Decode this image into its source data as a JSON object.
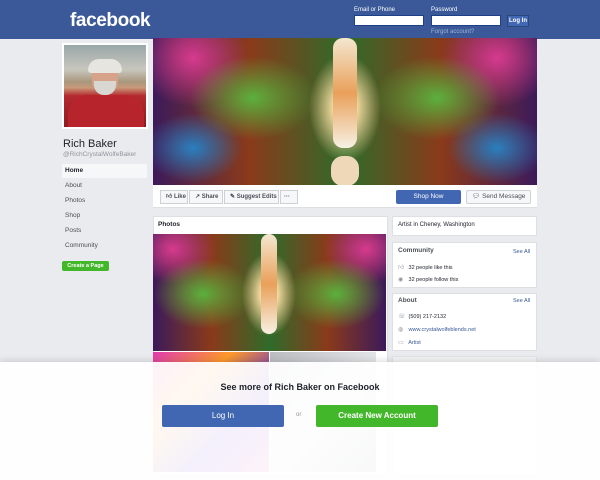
{
  "header": {
    "logo": "facebook",
    "email_label": "Email or Phone",
    "password_label": "Password",
    "login_button": "Log In",
    "forgot_link": "Forgot account?"
  },
  "profile": {
    "name": "Rich Baker",
    "handle": "@RichCrystalWolfeBaker"
  },
  "left_nav": {
    "items": [
      {
        "label": "Home",
        "active": true
      },
      {
        "label": "About"
      },
      {
        "label": "Photos"
      },
      {
        "label": "Shop"
      },
      {
        "label": "Posts"
      },
      {
        "label": "Community"
      }
    ],
    "create_page": "Create a Page"
  },
  "action_bar": {
    "like": "Like",
    "share": "Share",
    "suggest_edits": "Suggest Edits",
    "more": "···",
    "shop_now": "Shop Now",
    "send_message": "Send Message"
  },
  "photos": {
    "title": "Photos"
  },
  "right": {
    "category": "Artist in Cheney, Washington",
    "community": {
      "title": "Community",
      "see_all": "See All",
      "likes": "32 people like this",
      "follows": "32 people follow this"
    },
    "about": {
      "title": "About",
      "see_all": "See All",
      "phone": "(509) 217-2132",
      "website": "www.crystalwolfeblends.net",
      "category": "Artist"
    }
  },
  "overlay": {
    "title": "See more of Rich Baker on Facebook",
    "login": "Log In",
    "or": "or",
    "create": "Create New Account"
  },
  "colors": {
    "brand": "#3b5998",
    "button_blue": "#4267b2",
    "green": "#42b72a",
    "background": "#e9ebee"
  }
}
